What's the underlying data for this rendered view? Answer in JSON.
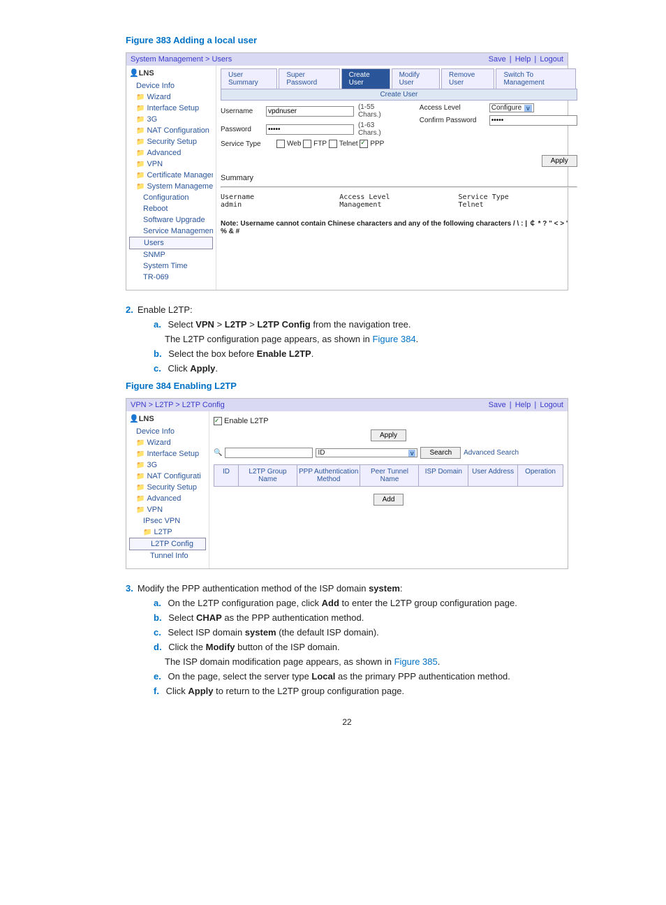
{
  "figure1": {
    "caption": "Figure 383 Adding a local user",
    "breadcrumb": "System Management > Users",
    "header_links": {
      "save": "Save",
      "help": "Help",
      "logout": "Logout"
    },
    "device": "LNS",
    "nav": [
      "Device Info",
      "Wizard",
      "Interface Setup",
      "3G",
      "NAT Configuration",
      "Security Setup",
      "Advanced",
      "VPN",
      "Certificate Manageme",
      "System Management",
      "Configuration",
      "Reboot",
      "Software Upgrade",
      "Service Management",
      "Users",
      "SNMP",
      "System Time",
      "TR-069"
    ],
    "tabs": [
      "User Summary",
      "Super Password",
      "Create User",
      "Modify User",
      "Remove User",
      "Switch To Management"
    ],
    "subbar": "Create User",
    "form": {
      "username_lbl": "Username",
      "username_val": "vpdnuser",
      "username_hint": "(1-55 Chars.)",
      "password_lbl": "Password",
      "password_val": "•••••",
      "password_hint": "(1-63 Chars.)",
      "service_lbl": "Service Type",
      "svc_web": "Web",
      "svc_ftp": "FTP",
      "svc_telnet": "Telnet",
      "svc_ppp": "PPP",
      "access_lbl": "Access Level",
      "access_val": "Configure",
      "confirm_lbl": "Confirm Password",
      "confirm_val": "•••••",
      "apply": "Apply"
    },
    "summary": {
      "title": "Summary",
      "col1h": "Username",
      "col1v": "admin",
      "col2h": "Access Level",
      "col2v": "Management",
      "col3h": "Service Type",
      "col3v": "Telnet"
    },
    "note_prefix": "Note: Username cannot contain Chinese characters and any of the following characters  / \\ :  |  ￠  * ? \" < > '",
    "note_suffix": "% & #"
  },
  "step2": {
    "num": "2.",
    "title": "Enable L2TP:",
    "a": {
      "l": "a.",
      "text_pre": "Select ",
      "b1": "VPN",
      "gt1": " > ",
      "b2": "L2TP",
      "gt2": " > ",
      "b3": "L2TP Config",
      "text_post": " from the navigation tree."
    },
    "a2": {
      "pre": "The L2TP configuration page appears, as shown in ",
      "link": "Figure 384",
      "post": "."
    },
    "b": {
      "l": "b.",
      "pre": "Select the box before ",
      "bold": "Enable L2TP",
      "post": "."
    },
    "c": {
      "l": "c.",
      "pre": "Click ",
      "bold": "Apply",
      "post": "."
    }
  },
  "figure2": {
    "caption": "Figure 384 Enabling L2TP",
    "breadcrumb": "VPN > L2TP > L2TP Config",
    "header_links": {
      "save": "Save",
      "help": "Help",
      "logout": "Logout"
    },
    "device": "LNS",
    "nav": [
      "Device Info",
      "Wizard",
      "Interface Setup",
      "3G",
      "NAT Configurati",
      "Security Setup",
      "Advanced",
      "VPN",
      "IPsec VPN",
      "L2TP",
      "L2TP Config",
      "Tunnel Info"
    ],
    "enable": "Enable L2TP",
    "apply": "Apply",
    "search_sel": "ID",
    "search_btn": "Search",
    "adv_search": "Advanced Search",
    "cols": [
      "ID",
      "L2TP Group Name",
      "PPP Authentication Method",
      "Peer Tunnel Name",
      "ISP Domain",
      "User Address",
      "Operation"
    ],
    "add": "Add"
  },
  "step3": {
    "num": "3.",
    "title_pre": "Modify the PPP authentication method of the ISP domain ",
    "title_bold": "system",
    "title_post": ":",
    "a": {
      "l": "a.",
      "pre": "On the L2TP configuration page, click ",
      "bold": "Add",
      "post": " to enter the L2TP group configuration page."
    },
    "b": {
      "l": "b.",
      "pre": "Select ",
      "bold": "CHAP",
      "post": " as the PPP authentication method."
    },
    "c": {
      "l": "c.",
      "pre": "Select ISP domain ",
      "bold": "system",
      "post": " (the default ISP domain)."
    },
    "d": {
      "l": "d.",
      "pre": "Click the ",
      "bold": "Modify",
      "post": " button of the ISP domain."
    },
    "d2": {
      "pre": "The ISP domain modification page appears, as shown in ",
      "link": "Figure 385",
      "post": "."
    },
    "e": {
      "l": "e.",
      "pre": "On the page, select the server type ",
      "bold": "Local",
      "post": " as the primary PPP authentication method."
    },
    "f": {
      "l": "f.",
      "pre": "Click ",
      "bold": "Apply",
      "post": " to return to the L2TP group configuration page."
    }
  },
  "page": "22"
}
